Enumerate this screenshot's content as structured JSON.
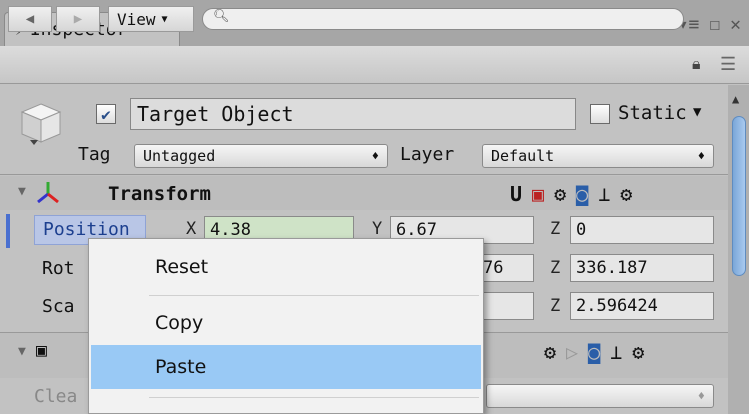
{
  "window": {
    "tab_title": "Inspector"
  },
  "toolbar": {
    "view_label": "View",
    "search_placeholder": ""
  },
  "header": {
    "object_name": "Target Object",
    "static_label": "Static",
    "tag_label": "Tag",
    "tag_value": "Untagged",
    "layer_label": "Layer",
    "layer_value": "Default"
  },
  "transform": {
    "title": "Transform",
    "rows": [
      {
        "label": "Position",
        "x": "4.38",
        "y": "6.67",
        "z": "0"
      },
      {
        "label": "Rot",
        "y_fragment": "76",
        "z": "336.187"
      },
      {
        "label": "Sca",
        "z": "2.596424"
      }
    ],
    "axis_labels": {
      "x": "X",
      "y": "Y",
      "z": "Z"
    }
  },
  "component2": {
    "clear_label": "Clea"
  },
  "context_menu": {
    "items": [
      "Reset",
      "Copy",
      "Paste"
    ],
    "highlighted": "Paste"
  },
  "colors": {
    "highlight": "#99c9f5",
    "position_field": "#cfe3c7",
    "scroll_thumb": "#7aa7d8"
  }
}
